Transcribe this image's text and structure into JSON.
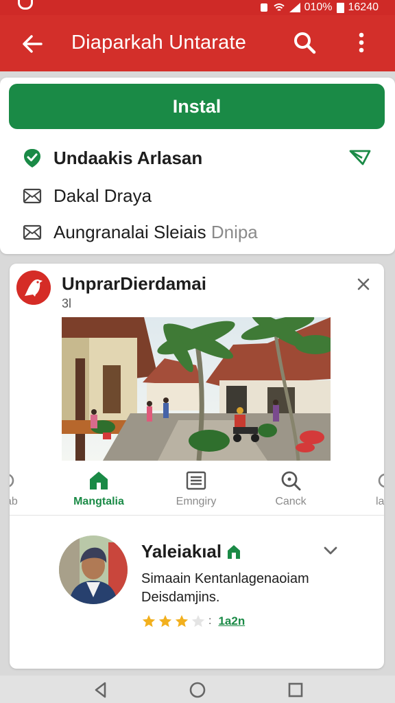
{
  "status_bar": {
    "battery_text": "010%",
    "time": "16240"
  },
  "app_bar": {
    "title": "Diaparkah Untarate"
  },
  "install_card": {
    "install_label": "Instal",
    "options": [
      {
        "label": "Undaakis Arlasan",
        "icon": "check-shield-icon"
      },
      {
        "label": "Dakal Draya",
        "icon": "mail-icon"
      },
      {
        "label": "Aungranalai Sleiais",
        "label_faded": "Dnipa",
        "icon": "mail-icon"
      }
    ]
  },
  "app_card": {
    "name": "UnprarDierdamai",
    "subtitle": "3l",
    "tabs": [
      {
        "label": "Mangtalia",
        "icon": "home-icon",
        "active": true
      },
      {
        "label": "Emngiry",
        "icon": "list-icon",
        "active": false
      },
      {
        "label": "Canck",
        "icon": "search-icon",
        "active": false
      }
    ],
    "tab_edge_left": "ab",
    "tab_edge_right": "la",
    "review": {
      "name": "Yaleiakıal",
      "text": "Simaain Kentanlagenaoiam Deisdamjins.",
      "rating": 3,
      "rating_max": 5,
      "rating_link": "1a2n"
    }
  },
  "colors": {
    "primary_red": "#d32f2a",
    "accent_green": "#1a8a46",
    "star": "#f2b01e"
  }
}
